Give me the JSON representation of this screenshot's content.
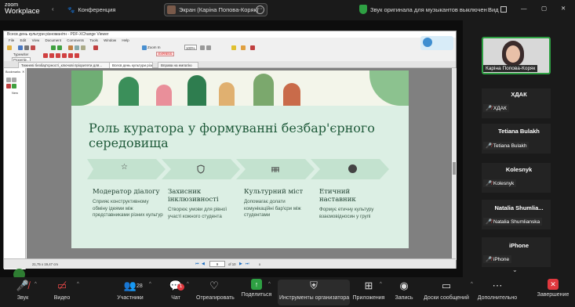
{
  "zoom_app": {
    "logo_top": "zoom",
    "logo_bottom": "Workplace",
    "conference_label": "Конференция",
    "share_label": "Экран (Каріна Попова-Коряк)",
    "original_sound_text": "Звук оригинала для музыкантов выключен",
    "view_label": "Вид"
  },
  "pdf_viewer": {
    "title": "Всесв день культури різноманітн - PDF-XChange Viewer",
    "menu": [
      "File",
      "Edit",
      "View",
      "Document",
      "Comments",
      "Tools",
      "Window",
      "Help"
    ],
    "zoom_value": "100%",
    "zoom_in_label": "Zoom In",
    "express_label": "EXPRESS",
    "typewriter_label": "Typewriter",
    "properties_label": "Propertie...",
    "tabs": [
      "Тижневі безбар'єрності_ключові пріоритети для...",
      "Всесв день культури різноманітн",
      "Вправа на емпатію"
    ],
    "sidebar_bookmarks_label": "Bookmarks",
    "sidebar_new_label": "New",
    "sidebar_options_label": "Options",
    "page_size": "21,75 x 19,47 cm",
    "page_current": "9",
    "page_total": "of 10",
    "zoom_indicator": "x"
  },
  "slide": {
    "title": "Роль куратора у формуванні безбар'єрного середовища",
    "icons": [
      "star-icon",
      "shield-icon",
      "bridge-icon",
      "balance-icon"
    ],
    "columns": [
      {
        "heading": "Модератор діалогу",
        "text": "Сприяє конструктивному обміну ідеями між представниками різних культур"
      },
      {
        "heading": "Захисник інклюзивності",
        "text": "Створює умови для рівної участі кожного студента"
      },
      {
        "heading": "Культурний міст",
        "text": "Допомагає долати комунікаційні бар'єри між студентами"
      },
      {
        "heading": "Етичний наставник",
        "text": "Формує етичну культуру взаємовідносин у групі"
      }
    ]
  },
  "participants": {
    "self_name": "Каріна Попова-Коряк",
    "list": [
      {
        "title": "ХДАК",
        "label": "ХДАК"
      },
      {
        "title": "Tetiana Bulakh",
        "label": "Tetiana Bulakh"
      },
      {
        "title": "Kolesnyk",
        "label": "Kolesnyk"
      },
      {
        "title": "Natalia Shumlia...",
        "label": "Natalia Shumlianska"
      },
      {
        "title": "iPhone",
        "label": "iPhone"
      }
    ]
  },
  "toolbar": {
    "audio": "Звук",
    "video": "Видео",
    "participants": "Участники",
    "participants_count": "28",
    "chat": "Чат",
    "chat_badge": "1",
    "react": "Отреагировать",
    "share": "Поделиться",
    "host_tools": "Инструменты организатора",
    "apps": "Приложения",
    "record": "Запись",
    "whiteboards": "Доски сообщений",
    "more": "Дополнительно",
    "end": "Завершение"
  },
  "colors": {
    "accent_green": "#2ea043",
    "slide_bg": "#dcefe4",
    "slide_title": "#1f5a3a",
    "end_red": "#e0383e"
  }
}
